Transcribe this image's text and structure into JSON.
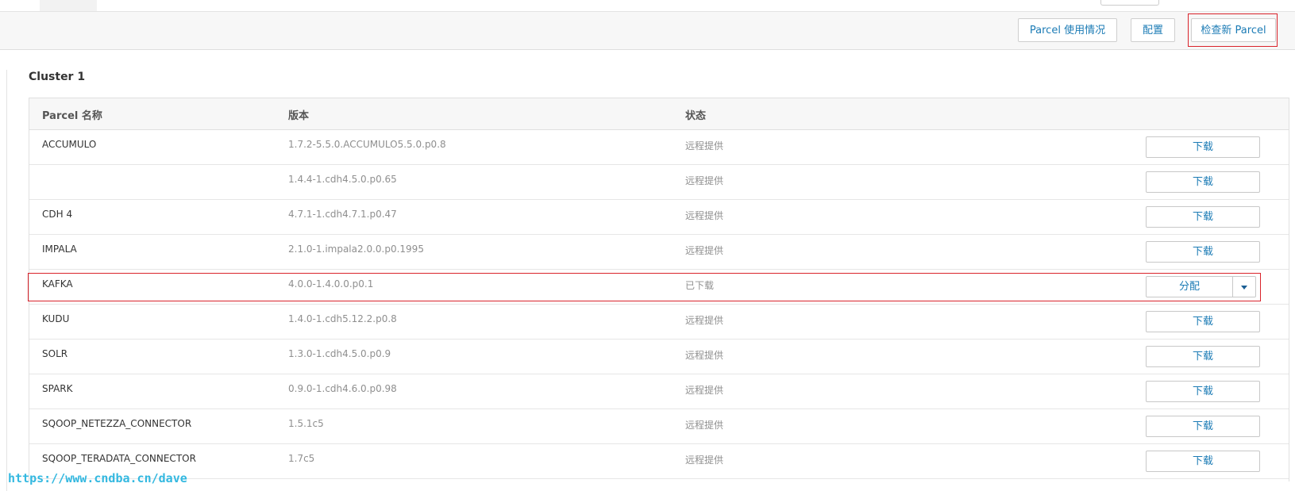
{
  "toolbar": {
    "usage_label": "Parcel 使用情况",
    "config_label": "配置",
    "check_label": "检查新 Parcel"
  },
  "cluster": {
    "title": "Cluster 1"
  },
  "table": {
    "headers": {
      "name": "Parcel 名称",
      "version": "版本",
      "status": "状态"
    },
    "rows": [
      {
        "name": "ACCUMULO",
        "version": "1.7.2-5.5.0.ACCUMULO5.5.0.p0.8",
        "status": "远程提供",
        "action": "下载"
      },
      {
        "name": "",
        "version": "1.4.4-1.cdh4.5.0.p0.65",
        "status": "远程提供",
        "action": "下载"
      },
      {
        "name": "CDH 4",
        "version": "4.7.1-1.cdh4.7.1.p0.47",
        "status": "远程提供",
        "action": "下载"
      },
      {
        "name": "IMPALA",
        "version": "2.1.0-1.impala2.0.0.p0.1995",
        "status": "远程提供",
        "action": "下载"
      },
      {
        "name": "KAFKA",
        "version": "4.0.0-1.4.0.0.p0.1",
        "status": "已下载",
        "action": "分配"
      },
      {
        "name": "KUDU",
        "version": "1.4.0-1.cdh5.12.2.p0.8",
        "status": "远程提供",
        "action": "下载"
      },
      {
        "name": "SOLR",
        "version": "1.3.0-1.cdh4.5.0.p0.9",
        "status": "远程提供",
        "action": "下载"
      },
      {
        "name": "SPARK",
        "version": "0.9.0-1.cdh4.6.0.p0.98",
        "status": "远程提供",
        "action": "下载"
      },
      {
        "name": "SQOOP_NETEZZA_CONNECTOR",
        "version": "1.5.1c5",
        "status": "远程提供",
        "action": "下载"
      },
      {
        "name": "SQOOP_TERADATA_CONNECTOR",
        "version": "1.7c5",
        "status": "远程提供",
        "action": "下载"
      }
    ]
  },
  "watermark": "https://www.cndba.cn/dave",
  "colors": {
    "accent": "#1b7bb5",
    "highlight": "#d9232b",
    "watermark": "#33b8e0"
  },
  "icons": {
    "split_caret": "caret-down-icon"
  }
}
